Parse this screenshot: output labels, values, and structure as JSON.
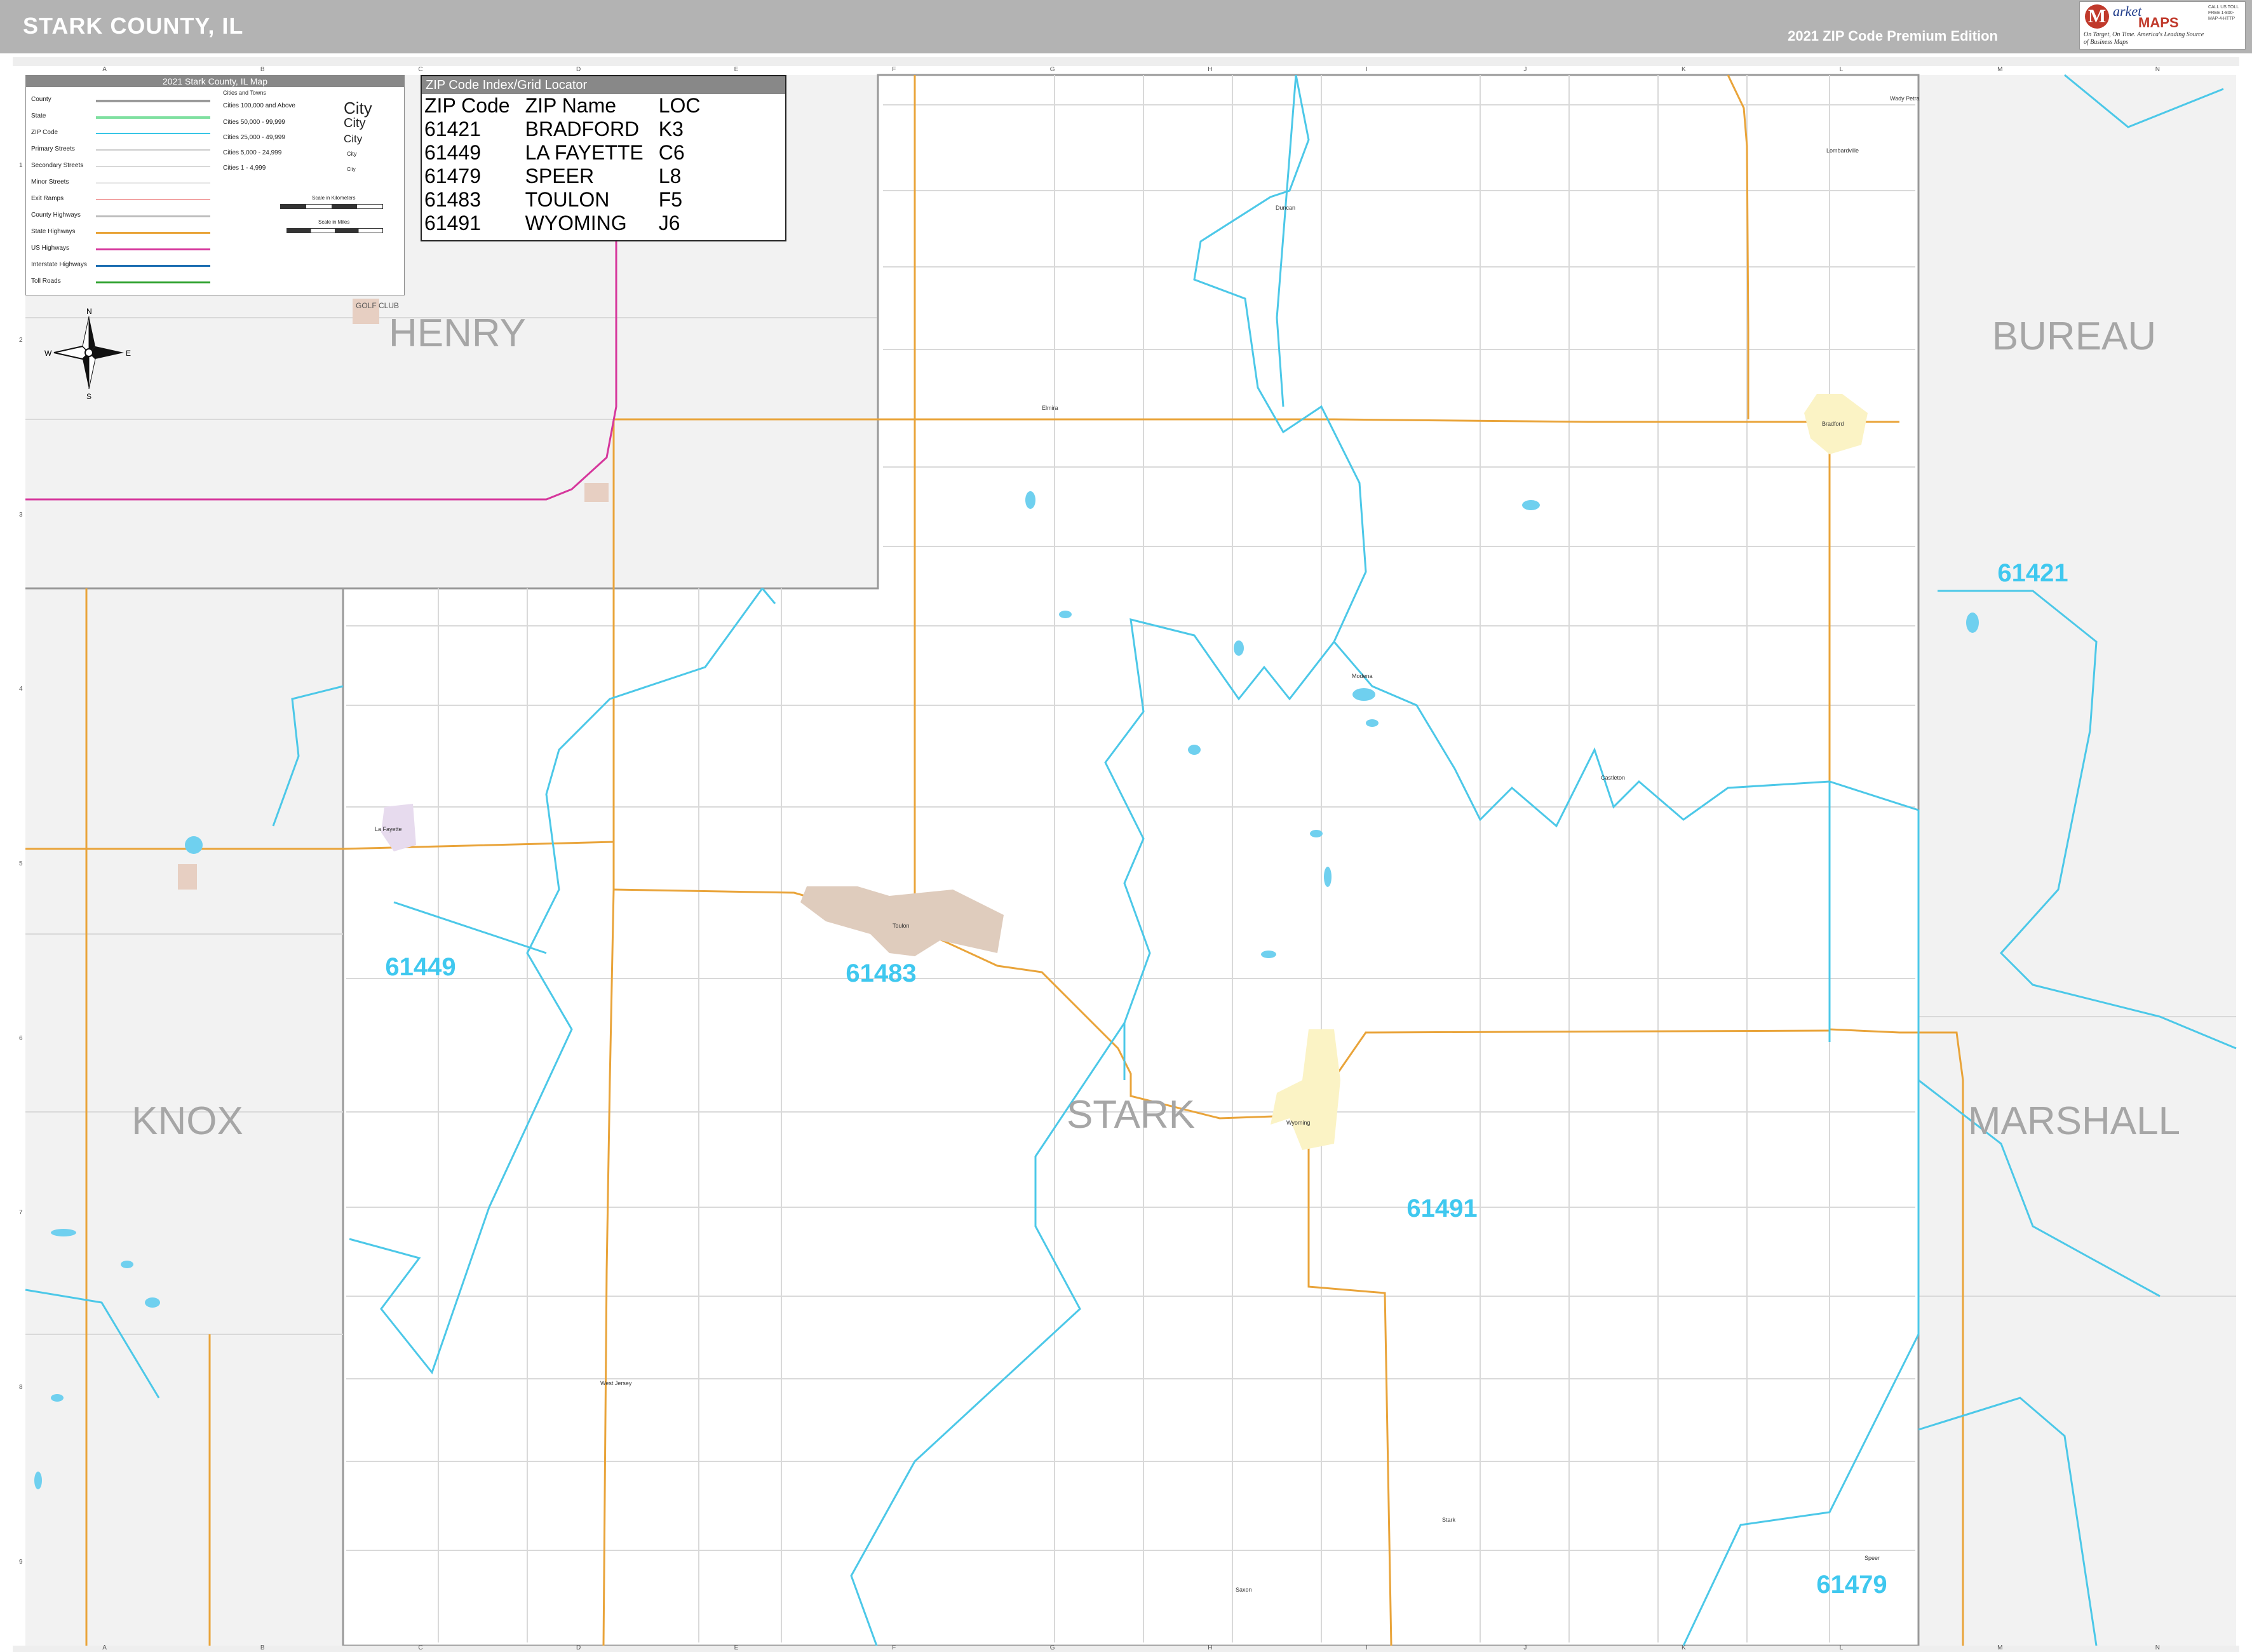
{
  "header": {
    "title": "STARK COUNTY, IL",
    "edition": "2021 ZIP Code Premium Edition"
  },
  "brand": {
    "logo_letter": "M",
    "name_top": "arket",
    "name_bottom": "MAPS",
    "tagline_1": "On Target, On Time.",
    "tagline_2": "America's Leading Source of Business Maps",
    "contact": "CALL US TOLL FREE 1-800-MAP-4-HTTP"
  },
  "grid": {
    "columns": [
      "A",
      "B",
      "C",
      "D",
      "E",
      "F",
      "G",
      "H",
      "I",
      "J",
      "K",
      "L",
      "M",
      "N"
    ],
    "rows": [
      "1",
      "2",
      "3",
      "4",
      "5",
      "6",
      "7",
      "8",
      "9"
    ]
  },
  "legend": {
    "title": "2021 Stark County, IL Map",
    "items": [
      "County",
      "State",
      "ZIP Code",
      "Primary Streets",
      "Secondary Streets",
      "Minor Streets",
      "Exit Ramps",
      "County Highways",
      "State Highways",
      "US Highways",
      "Interstate Highways",
      "Toll Roads"
    ],
    "colors": [
      "#9a9a9a",
      "#7fe0a0",
      "#39c6e6",
      "#cccccc",
      "#d8d8d8",
      "#e6e6e6",
      "#f2a3a3",
      "#bdbdbd",
      "#e9a43a",
      "#d6379c",
      "#1f6fb2",
      "#2aa02a"
    ],
    "cities_header": "Cities and Towns",
    "cities": [
      "Cities 100,000 and Above",
      "Cities 50,000 - 99,999",
      "Cities 25,000 - 49,999",
      "Cities 5,000 - 24,999",
      "Cities 1 - 4,999"
    ],
    "city_samples": [
      "City",
      "City",
      "City",
      "City",
      "City"
    ],
    "scale_km": "Scale in Kilometers",
    "scale_mi": "Scale in Miles"
  },
  "zip_index": {
    "title": "ZIP Code Index/Grid Locator",
    "headers": [
      "ZIP Code",
      "ZIP Name",
      "LOC"
    ],
    "rows": [
      [
        "61421",
        "BRADFORD",
        "K3"
      ],
      [
        "61449",
        "LA FAYETTE",
        "C6"
      ],
      [
        "61479",
        "SPEER",
        "L8"
      ],
      [
        "61483",
        "TOULON",
        "F5"
      ],
      [
        "61491",
        "WYOMING",
        "J6"
      ]
    ]
  },
  "compass": {
    "n": "N",
    "s": "S",
    "e": "E",
    "w": "W"
  },
  "counties": {
    "henry": "HENRY",
    "bureau": "BUREAU",
    "knox": "KNOX",
    "stark": "STARK",
    "marshall": "MARSHALL"
  },
  "zip_labels": {
    "z61421": "61421",
    "z61449": "61449",
    "z61483": "61483",
    "z61491": "61491",
    "z61479": "61479"
  },
  "places": {
    "golf": "GOLF CLUB",
    "bradford": "Bradford",
    "lafayette": "La Fayette",
    "toulon": "Toulon",
    "wyoming": "Wyoming",
    "westjersey": "West Jersey",
    "castleton": "Castleton",
    "duncan": "Duncan",
    "modena": "Modena",
    "elmira": "Elmira",
    "speer": "Speer",
    "stark": "Stark",
    "saxon": "Saxon",
    "lombardville": "Lombardville",
    "wady": "Wady Petra"
  },
  "colors": {
    "zip_boundary": "#4cc8e8",
    "state_hwy": "#e9a43a",
    "us_hwy": "#d6379c",
    "county_bg": "#f2f2f2",
    "zip_text": "#3fc8ef",
    "county_text": "#a6a6a6"
  }
}
